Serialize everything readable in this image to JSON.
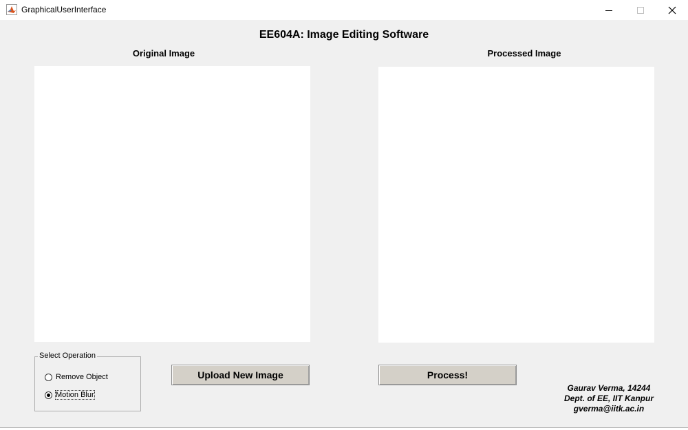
{
  "window": {
    "title": "GraphicalUserInterface",
    "icon": "matlab-icon"
  },
  "heading": "EE604A: Image Editing Software",
  "panels": {
    "original_label": "Original Image",
    "processed_label": "Processed Image"
  },
  "operation_group": {
    "title": "Select Operation",
    "options": [
      {
        "label": "Remove Object",
        "selected": false
      },
      {
        "label": "Motion Blur",
        "selected": true
      }
    ]
  },
  "buttons": {
    "upload_label": "Upload New Image",
    "process_label": "Process!"
  },
  "credits": {
    "line1": "Gaurav Verma, 14244",
    "line2": "Dept. of EE, IIT Kanpur",
    "line3": "gverma@iitk.ac.in"
  },
  "colors": {
    "window_bg": "#f0f0f0",
    "button_bg": "#d4d0c8",
    "axes_bg": "#ffffff"
  }
}
